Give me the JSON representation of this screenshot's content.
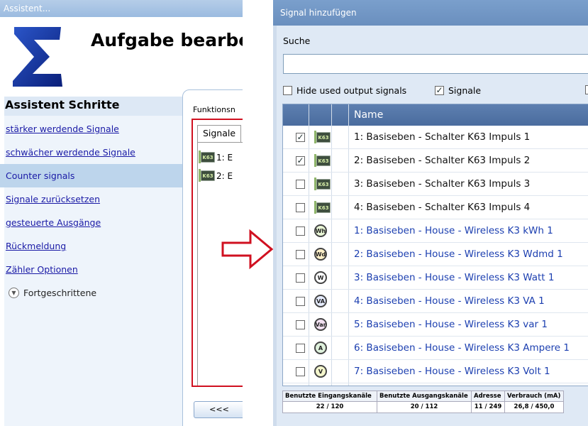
{
  "left_window": {
    "title": "Assistent...",
    "heading": "Aufgabe bearbe",
    "steps_title": "Assistent Schritte",
    "steps": [
      {
        "label": "stärker werdende Signale",
        "active": false
      },
      {
        "label": "schwächer werdende Signale",
        "active": false
      },
      {
        "label": "Counter signals",
        "active": true
      },
      {
        "label": "Signale zurücksetzen",
        "active": false
      },
      {
        "label": "gesteuerte Ausgänge",
        "active": false
      },
      {
        "label": "Rückmeldung",
        "active": false
      },
      {
        "label": "Zähler Optionen",
        "active": false
      }
    ],
    "advanced_label": "Fortgeschrittene",
    "function_label": "Funktionsn",
    "tab_label": "Signale",
    "list_items": [
      "1: E",
      "2: E"
    ],
    "nav_button": "<<<"
  },
  "dialog": {
    "title": "Signal hinzufügen",
    "search_label": "Suche",
    "search_value": "",
    "hide_used": {
      "label": "Hide used output signals",
      "checked": false
    },
    "signale": {
      "label": "Signale",
      "checked": true
    },
    "column_name": "Name",
    "rows": [
      {
        "checked": true,
        "icon": "k63-chip-icon",
        "glyph": "K63",
        "name": "1: Basiseben - Schalter K63 Impuls 1",
        "color": "black"
      },
      {
        "checked": true,
        "icon": "k63-chip-icon",
        "glyph": "K63",
        "name": "2: Basiseben - Schalter K63 Impuls 2",
        "color": "black"
      },
      {
        "checked": false,
        "icon": "k63-chip-icon",
        "glyph": "K63",
        "name": "3: Basiseben - Schalter K63 Impuls 3",
        "color": "black"
      },
      {
        "checked": false,
        "icon": "k63-chip-icon",
        "glyph": "K63",
        "name": "4: Basiseben - Schalter K63 Impuls 4",
        "color": "black"
      },
      {
        "checked": false,
        "icon": "kwh-meter-icon",
        "glyph": "Wh",
        "name": "1: Basiseben - House - Wireless K3 kWh 1",
        "color": "blue"
      },
      {
        "checked": false,
        "icon": "wdmd-meter-icon",
        "glyph": "Wd",
        "name": "2: Basiseben - House - Wireless K3 Wdmd 1",
        "color": "blue"
      },
      {
        "checked": false,
        "icon": "watt-meter-icon",
        "glyph": "W",
        "name": "3: Basiseben - House - Wireless K3 Watt 1",
        "color": "blue"
      },
      {
        "checked": false,
        "icon": "va-meter-icon",
        "glyph": "VA",
        "name": "4: Basiseben - House - Wireless K3 VA 1",
        "color": "blue"
      },
      {
        "checked": false,
        "icon": "var-meter-icon",
        "glyph": "Var",
        "name": "5: Basiseben - House - Wireless K3 var 1",
        "color": "blue"
      },
      {
        "checked": false,
        "icon": "ampere-meter-icon",
        "glyph": "A",
        "name": "6: Basiseben - House - Wireless K3 Ampere 1",
        "color": "blue"
      },
      {
        "checked": false,
        "icon": "volt-meter-icon",
        "glyph": "V",
        "name": "7: Basiseben - House - Wireless K3 Volt 1",
        "color": "blue"
      }
    ],
    "status": [
      {
        "header": "Benutzte Eingangskanäle",
        "value": "22 / 120"
      },
      {
        "header": "Benutzte Ausgangskanäle",
        "value": "20 / 112"
      },
      {
        "header": "Adresse",
        "value": "11 / 249"
      },
      {
        "header": "Verbrauch (mA)",
        "value": "26,8 / 450,0"
      }
    ]
  },
  "colors": {
    "highlight_frame": "#d01020",
    "header_blue": "#4a6c9e",
    "link_blue": "#1c3fb0"
  }
}
